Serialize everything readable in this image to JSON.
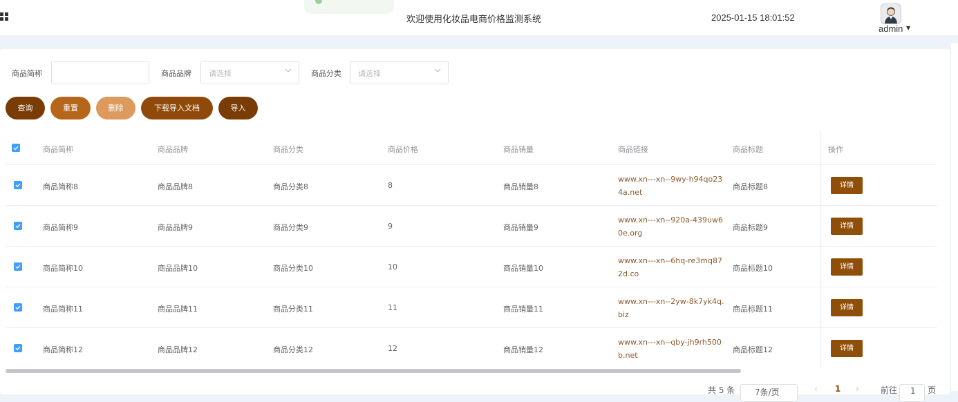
{
  "header": {
    "title": "欢迎使用化妆品电商价格监测系统",
    "datetime": "2025-01-15 18:01:52",
    "user": "admin"
  },
  "search": {
    "name_label": "商品简称",
    "name_value": "",
    "brand_label": "商品品牌",
    "brand_placeholder": "请选择",
    "category_label": "商品分类",
    "category_placeholder": "请选择"
  },
  "toolbar": {
    "query": "查询",
    "reset": "重置",
    "delete": "删除",
    "download": "下载导入文档",
    "import": "导入"
  },
  "colors": {
    "query": "#7a3c05",
    "reset": "#b5661a",
    "delete": "#dc9b5c",
    "download": "#8f4a0a",
    "import": "#7a3c05",
    "detail": "#8f4f08",
    "link": "#8b5a2b"
  },
  "table": {
    "headers": [
      "商品简称",
      "商品品牌",
      "商品分类",
      "商品价格",
      "商品销量",
      "商品链接",
      "商品标题",
      "操作"
    ],
    "rows": [
      {
        "name": "商品简称8",
        "brand": "商品品牌8",
        "category": "商品分类8",
        "price": "8",
        "sales": "商品销量8",
        "link": "www.xn---xn--9wy-h94qo234a.net",
        "title": "商品标题8",
        "action": "详情"
      },
      {
        "name": "商品简称9",
        "brand": "商品品牌9",
        "category": "商品分类9",
        "price": "9",
        "sales": "商品销量9",
        "link": "www.xn---xn--920a-439uw60e.org",
        "title": "商品标题9",
        "action": "详情"
      },
      {
        "name": "商品简称10",
        "brand": "商品品牌10",
        "category": "商品分类10",
        "price": "10",
        "sales": "商品销量10",
        "link": "www.xn---xn--6hq-re3mq872d.co",
        "title": "商品标题10",
        "action": "详情"
      },
      {
        "name": "商品简称11",
        "brand": "商品品牌11",
        "category": "商品分类11",
        "price": "11",
        "sales": "商品销量11",
        "link": "www.xn---xn--2yw-8k7yk4q.biz",
        "title": "商品标题11",
        "action": "详情"
      },
      {
        "name": "商品简称12",
        "brand": "商品品牌12",
        "category": "商品分类12",
        "price": "12",
        "sales": "商品销量12",
        "link": "www.xn---xn--qby-jh9rh500b.net",
        "title": "商品标题12",
        "action": "详情"
      }
    ]
  },
  "pagination": {
    "total": "共 5 条",
    "page_size": "7条/页",
    "current_page": "1",
    "goto_label": "前往",
    "goto_value": "1",
    "page_suffix": "页"
  }
}
